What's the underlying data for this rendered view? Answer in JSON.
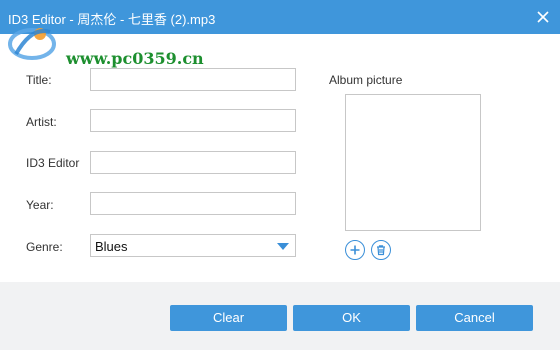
{
  "window": {
    "title": "ID3 Editor - 周杰伦 - 七里香 (2).mp3"
  },
  "watermark": {
    "site": "www.pc0359.cn"
  },
  "form": {
    "title_label": "Title:",
    "title_value": "",
    "artist_label": "Artist:",
    "artist_value": "",
    "album_label": "ID3 Editor",
    "album_value": "",
    "year_label": "Year:",
    "year_value": "",
    "genre_label": "Genre:",
    "genre_value": "Blues"
  },
  "album_picture": {
    "label": "Album picture"
  },
  "buttons": {
    "clear": "Clear",
    "ok": "OK",
    "cancel": "Cancel"
  },
  "colors": {
    "accent": "#3f96db",
    "footer_bg": "#f1f2f3",
    "watermark_green": "#1d8f2f"
  },
  "icons": {
    "close": "close-icon",
    "add": "plus-circle-icon",
    "delete": "trash-icon",
    "dropdown": "chevron-down-icon"
  }
}
